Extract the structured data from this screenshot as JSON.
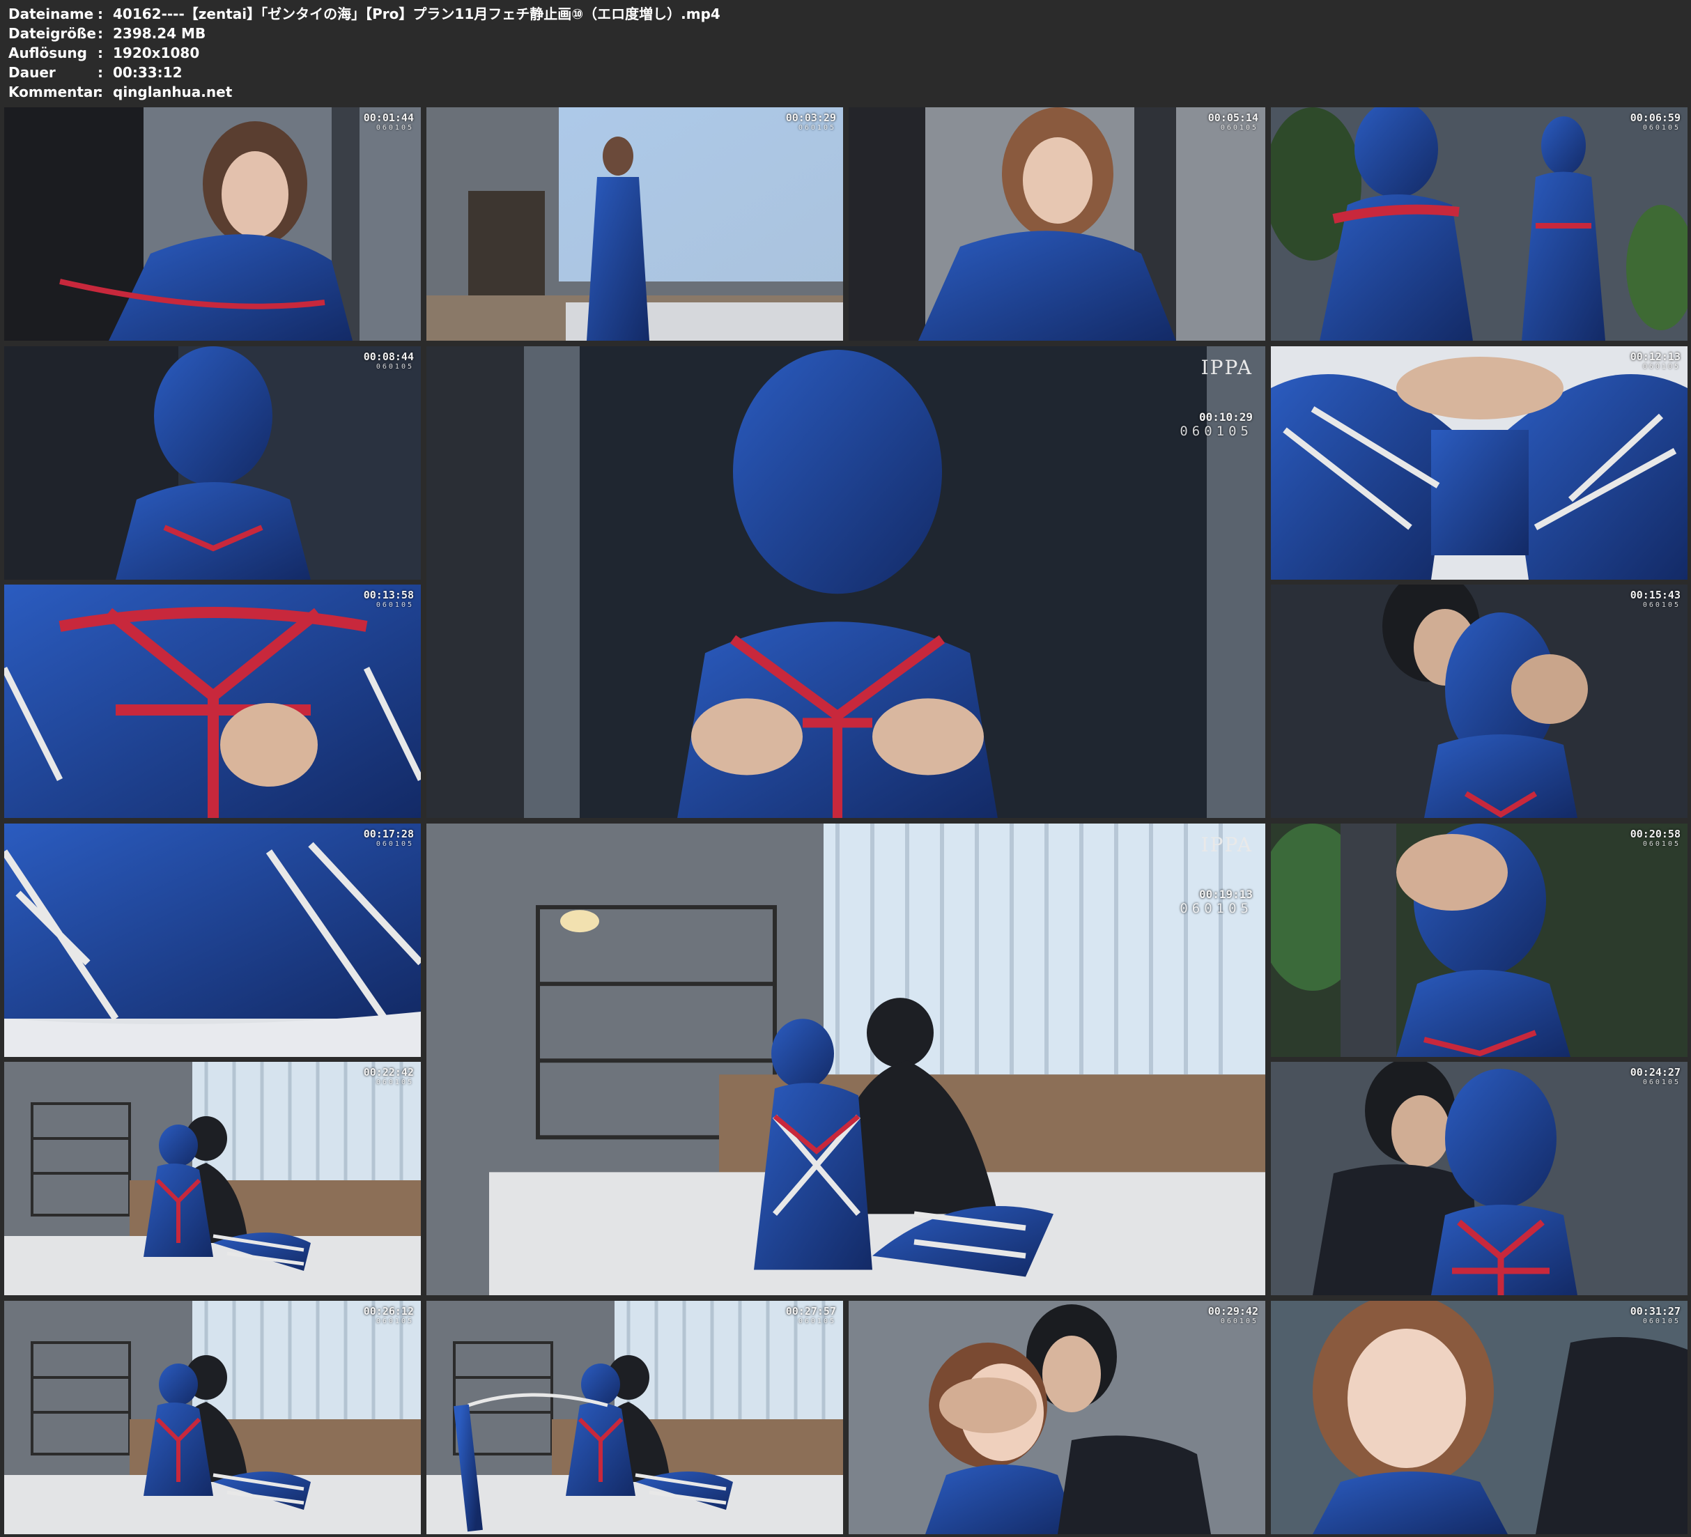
{
  "header": {
    "rows": [
      {
        "key": "Dateiname",
        "sep": ":",
        "value": "40162----【zentai】「ゼンタイの海」【Pro】プラン11月フェチ静止画⑩（エロ度増し）.mp4"
      },
      {
        "key": "Dateigröße",
        "sep": ":",
        "value": "2398.24 MB"
      },
      {
        "key": "Auflösung",
        "sep": ":",
        "value": "1920x1080"
      },
      {
        "key": "Dauer",
        "sep": ":",
        "value": "00:33:12"
      },
      {
        "key": "Kommentar",
        "sep": ":",
        "value": "qinglanhua.net"
      }
    ]
  },
  "code": "060105",
  "ippa_logo": "IPPA",
  "thumbnails": [
    {
      "time": "00:01:44",
      "scene": "woman-closeup-blue"
    },
    {
      "time": "00:03:29",
      "scene": "room-standing"
    },
    {
      "time": "00:05:14",
      "scene": "woman-hair"
    },
    {
      "time": "00:06:59",
      "scene": "two-figures-plants"
    },
    {
      "time": "00:08:44",
      "scene": "hooded-figure"
    },
    {
      "time": "00:10:29",
      "scene": "big-chest-rope"
    },
    {
      "time": "00:12:13",
      "scene": "legs-white-rope"
    },
    {
      "time": "00:13:58",
      "scene": "chest-red-rope"
    },
    {
      "time": "00:15:43",
      "scene": "man-hooded-closeup"
    },
    {
      "time": "00:17:28",
      "scene": "legs-closeup"
    },
    {
      "time": "00:19:13",
      "scene": "big-bedroom"
    },
    {
      "time": "00:20:58",
      "scene": "hand-on-hood"
    },
    {
      "time": "00:22:42",
      "scene": "bedroom-wide"
    },
    {
      "time": "00:24:27",
      "scene": "man-hooded-red"
    },
    {
      "time": "00:26:12",
      "scene": "bedroom-wide"
    },
    {
      "time": "00:27:57",
      "scene": "bedroom-wide-rope"
    },
    {
      "time": "00:29:42",
      "scene": "face-hand"
    },
    {
      "time": "00:31:27",
      "scene": "woman-face"
    }
  ],
  "colors": {
    "background": "#2b2b2b",
    "suit_blue": "#1f3f8f",
    "rope_red": "#c8283c",
    "rope_white": "#e8e8e8"
  }
}
